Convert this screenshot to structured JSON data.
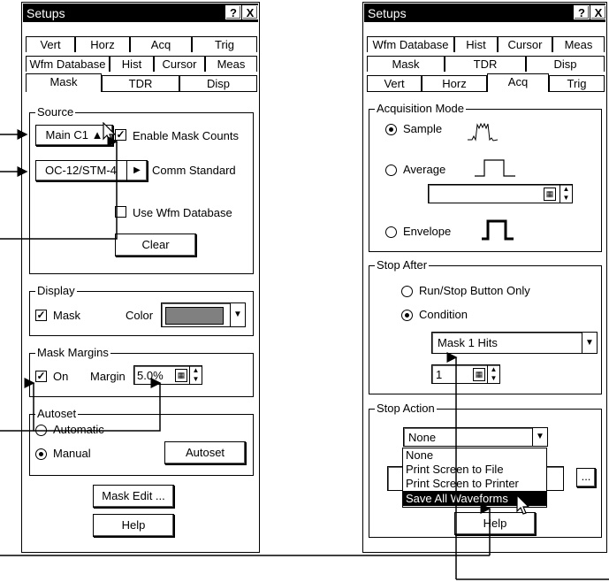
{
  "left": {
    "title": "Setups",
    "help_btn": "?",
    "close_btn": "X",
    "tabs_row1": [
      "Vert",
      "Horz",
      "Acq",
      "Trig"
    ],
    "tabs_row2": [
      "Wfm Database",
      "Hist",
      "Cursor",
      "Meas"
    ],
    "tabs_row3": [
      "Mask",
      "TDR",
      "Disp"
    ],
    "source": {
      "legend": "Source",
      "main_btn": "Main C1",
      "enable_mask_counts": "Enable Mask Counts",
      "standard_btn": "OC-12/STM-4",
      "comm_standard": "Comm Standard",
      "use_wfm_db": "Use Wfm Database",
      "clear": "Clear"
    },
    "display": {
      "legend": "Display",
      "mask": "Mask",
      "color": "Color",
      "color_value": "#808080"
    },
    "margins": {
      "legend": "Mask Margins",
      "on": "On",
      "margin": "Margin",
      "value": "5.0%"
    },
    "autoset": {
      "legend": "Autoset",
      "automatic": "Automatic",
      "manual": "Manual",
      "btn": "Autoset"
    },
    "mask_edit": "Mask Edit ...",
    "help": "Help"
  },
  "right": {
    "title": "Setups",
    "help_btn": "?",
    "close_btn": "X",
    "tabs_row1": [
      "Wfm Database",
      "Hist",
      "Cursor",
      "Meas"
    ],
    "tabs_row2": [
      "Mask",
      "TDR",
      "Disp"
    ],
    "tabs_row3": [
      "Vert",
      "Horz",
      "Acq",
      "Trig"
    ],
    "acq_mode": {
      "legend": "Acquisition Mode",
      "sample": "Sample",
      "average": "Average",
      "envelope": "Envelope"
    },
    "stop_after": {
      "legend": "Stop After",
      "run_stop": "Run/Stop Button Only",
      "condition": "Condition",
      "condition_value": "Mask 1 Hits",
      "count": "1"
    },
    "stop_action": {
      "legend": "Stop Action",
      "value": "None",
      "options": [
        "None",
        "Print Screen to File",
        "Print Screen to Printer",
        "Save All Waveforms"
      ],
      "browse": "..."
    },
    "help": "Help"
  }
}
